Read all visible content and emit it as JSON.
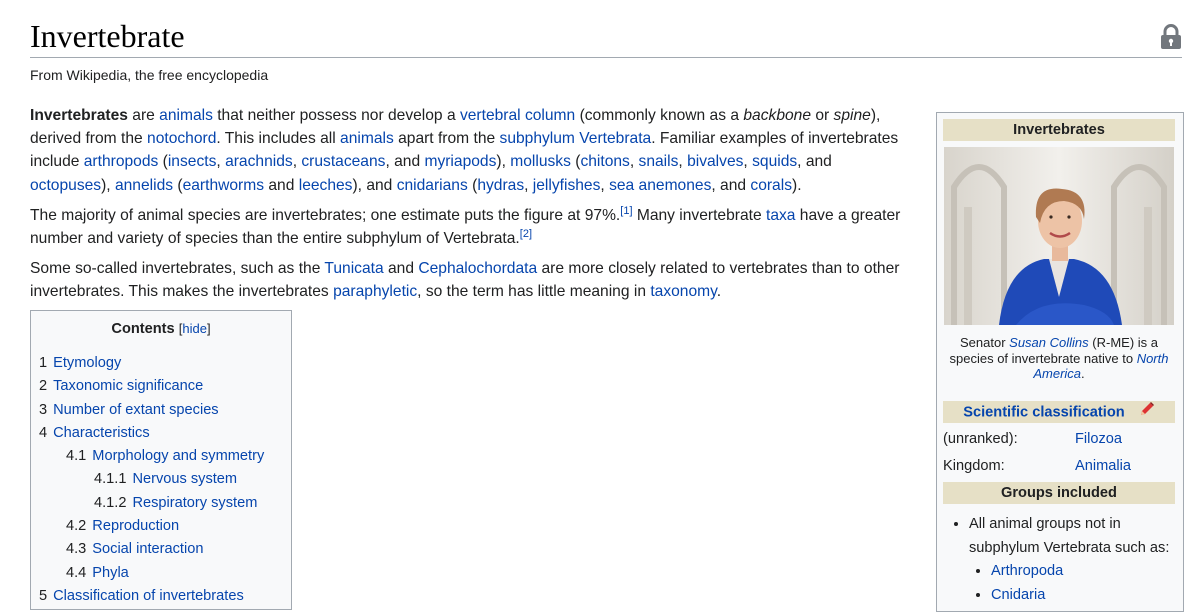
{
  "page": {
    "title": "Invertebrate",
    "tagline": "From Wikipedia, the free encyclopedia",
    "lock_icon": "lock-icon"
  },
  "intro": {
    "p1": [
      {
        "t": "Invertebrates",
        "s": "bold"
      },
      {
        "t": " are "
      },
      {
        "t": "animals",
        "s": "link"
      },
      {
        "t": " that neither possess nor develop a "
      },
      {
        "t": "vertebral column",
        "s": "link"
      },
      {
        "t": " (commonly known as a "
      },
      {
        "t": "backbone",
        "s": "italic"
      },
      {
        "t": " or "
      },
      {
        "t": "spine",
        "s": "italic"
      },
      {
        "t": "), derived from the "
      },
      {
        "t": "notochord",
        "s": "link"
      },
      {
        "t": ". This includes all "
      },
      {
        "t": "animals",
        "s": "link"
      },
      {
        "t": " apart from the "
      },
      {
        "t": "subphylum Vertebrata",
        "s": "link"
      },
      {
        "t": ". Familiar examples of invertebrates include "
      },
      {
        "t": "arthropods",
        "s": "link"
      },
      {
        "t": " ("
      },
      {
        "t": "insects",
        "s": "link"
      },
      {
        "t": ", "
      },
      {
        "t": "arachnids",
        "s": "link"
      },
      {
        "t": ", "
      },
      {
        "t": "crustaceans",
        "s": "link"
      },
      {
        "t": ", and "
      },
      {
        "t": "myriapods",
        "s": "link"
      },
      {
        "t": "), "
      },
      {
        "t": "mollusks",
        "s": "link"
      },
      {
        "t": " ("
      },
      {
        "t": "chitons",
        "s": "link"
      },
      {
        "t": ", "
      },
      {
        "t": "snails",
        "s": "link"
      },
      {
        "t": ", "
      },
      {
        "t": "bivalves",
        "s": "link"
      },
      {
        "t": ", "
      },
      {
        "t": "squids",
        "s": "link"
      },
      {
        "t": ", and "
      },
      {
        "t": "octopuses",
        "s": "link"
      },
      {
        "t": "), "
      },
      {
        "t": "annelids",
        "s": "link"
      },
      {
        "t": " ("
      },
      {
        "t": "earthworms",
        "s": "link"
      },
      {
        "t": " and "
      },
      {
        "t": "leeches",
        "s": "link"
      },
      {
        "t": "), and "
      },
      {
        "t": "cnidarians",
        "s": "link"
      },
      {
        "t": " ("
      },
      {
        "t": "hydras",
        "s": "link"
      },
      {
        "t": ", "
      },
      {
        "t": "jellyfishes",
        "s": "link"
      },
      {
        "t": ", "
      },
      {
        "t": "sea anemones",
        "s": "link"
      },
      {
        "t": ", and "
      },
      {
        "t": "corals",
        "s": "link"
      },
      {
        "t": ")."
      }
    ],
    "p2": [
      {
        "t": "The majority of animal species are invertebrates; one estimate puts the figure at 97%."
      },
      {
        "t": "[1]",
        "s": "sup"
      },
      {
        "t": " Many invertebrate "
      },
      {
        "t": "taxa",
        "s": "link"
      },
      {
        "t": " have a greater number and variety of species than the entire subphylum of Vertebrata."
      },
      {
        "t": "[2]",
        "s": "sup"
      }
    ],
    "p3": [
      {
        "t": "Some so-called invertebrates, such as the "
      },
      {
        "t": "Tunicata",
        "s": "link"
      },
      {
        "t": " and "
      },
      {
        "t": "Cephalochordata",
        "s": "link"
      },
      {
        "t": " are more closely related to vertebrates than to other invertebrates. This makes the invertebrates "
      },
      {
        "t": "paraphyletic",
        "s": "link"
      },
      {
        "t": ", so the term has little meaning in "
      },
      {
        "t": "taxonomy",
        "s": "link"
      },
      {
        "t": "."
      }
    ]
  },
  "toc": {
    "title": "Contents",
    "hide": "[hide]",
    "items": [
      {
        "num": "1",
        "label": "Etymology",
        "level": 1
      },
      {
        "num": "2",
        "label": "Taxonomic significance",
        "level": 1
      },
      {
        "num": "3",
        "label": "Number of extant species",
        "level": 1
      },
      {
        "num": "4",
        "label": "Characteristics",
        "level": 1
      },
      {
        "num": "4.1",
        "label": "Morphology and symmetry",
        "level": 2
      },
      {
        "num": "4.1.1",
        "label": "Nervous system",
        "level": 3
      },
      {
        "num": "4.1.2",
        "label": "Respiratory system",
        "level": 3
      },
      {
        "num": "4.2",
        "label": "Reproduction",
        "level": 2
      },
      {
        "num": "4.3",
        "label": "Social interaction",
        "level": 2
      },
      {
        "num": "4.4",
        "label": "Phyla",
        "level": 2
      },
      {
        "num": "5",
        "label": "Classification of invertebrates",
        "level": 1
      }
    ]
  },
  "infobox": {
    "title": "Invertebrates",
    "caption": [
      {
        "t": "Senator "
      },
      {
        "t": "Susan Collins",
        "s": "link"
      },
      {
        "t": " (R-ME) is a species of invertebrate native to "
      },
      {
        "t": "North America",
        "s": "link"
      },
      {
        "t": "."
      }
    ],
    "sci_class": "Scientific classification",
    "edit_icon": "pencil-icon",
    "rows": [
      {
        "label": "(unranked):",
        "value": "Filozoa"
      },
      {
        "label": "Kingdom:",
        "value": "Animalia"
      }
    ],
    "groups_title": "Groups included",
    "groups_item": "All animal groups not in subphylum Vertebrata such as:",
    "groups_sub": [
      "Arthropoda",
      "Cnidaria"
    ]
  },
  "colors": {
    "link": "#0645ad",
    "band": "#e6e0c6",
    "border": "#a2a9b1"
  }
}
